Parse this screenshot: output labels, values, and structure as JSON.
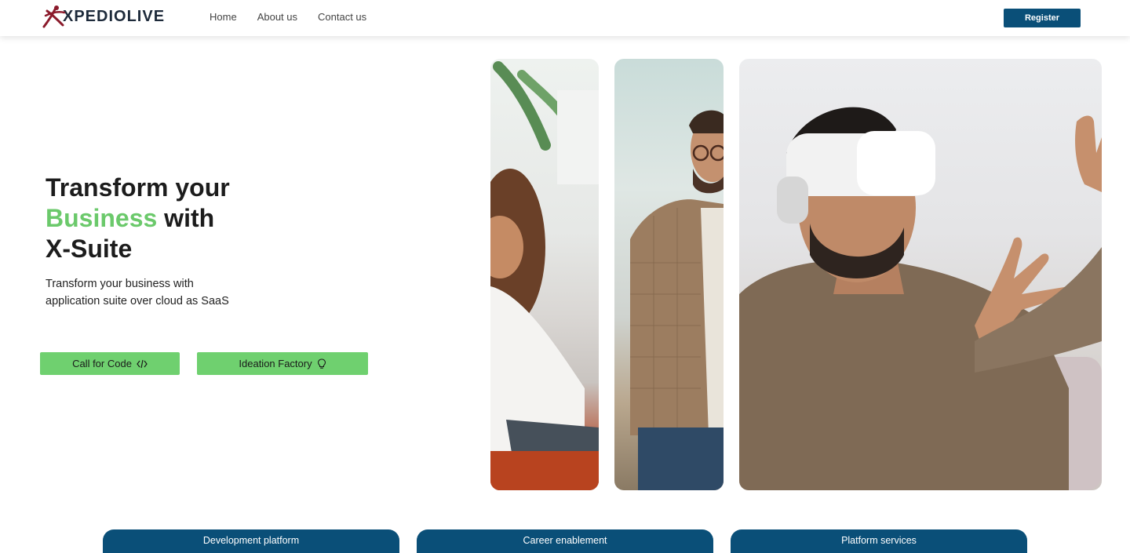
{
  "header": {
    "logo_text": "XPEDIOLIVE",
    "nav": [
      "Home",
      "About us",
      "Contact us"
    ],
    "register_label": "Register"
  },
  "hero": {
    "title_line1": "Transform your",
    "title_accent": "Business",
    "title_line2_rest": " with",
    "title_line3": "X-Suite",
    "subtitle": "Transform your business with application suite over cloud as SaaS",
    "cta_code_label": "Call for Code",
    "cta_idea_label": "Ideation Factory"
  },
  "tabs": [
    "Development platform",
    "Career enablement",
    "Platform services"
  ],
  "colors": {
    "brand_blue": "#0a4f78",
    "accent_green": "#6bc96b",
    "button_green": "#6fd06f",
    "logo_red": "#8b1a2b"
  },
  "icons": {
    "cta_code": "code-icon",
    "cta_idea": "lightbulb-icon"
  }
}
